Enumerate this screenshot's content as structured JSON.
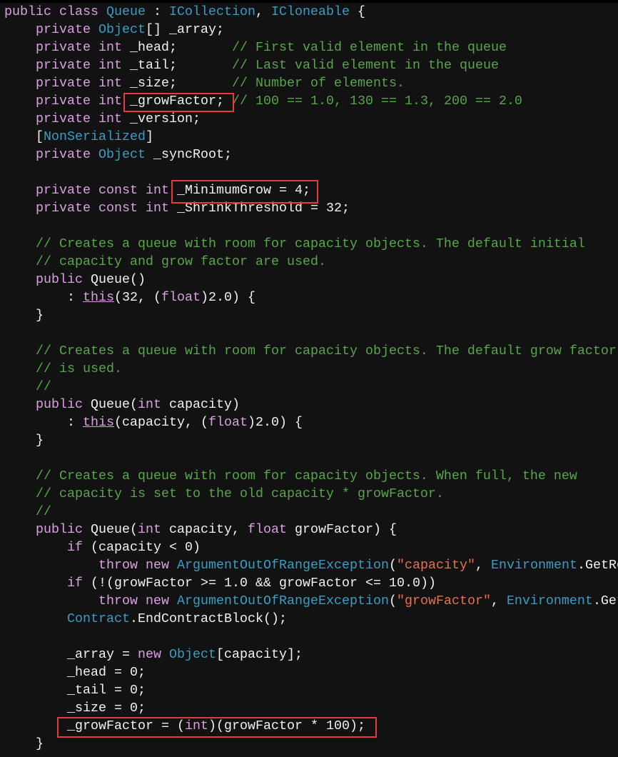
{
  "colors": {
    "background": "#121212",
    "keyword": "#d8a0df",
    "type": "#3a9dc4",
    "comment": "#57a64a",
    "string": "#e8704f",
    "text": "#f1f1f1",
    "highlight_box": "#e8393b"
  },
  "code_lines": [
    [
      [
        "k",
        "public"
      ],
      " ",
      [
        "k",
        "class"
      ],
      " ",
      [
        "t",
        "Queue"
      ],
      " : ",
      [
        "t",
        "ICollection"
      ],
      ", ",
      [
        "t",
        "ICloneable"
      ],
      " {"
    ],
    [
      "    ",
      [
        "k",
        "private"
      ],
      " ",
      [
        "t",
        "Object"
      ],
      "[] _array;"
    ],
    [
      "    ",
      [
        "k",
        "private"
      ],
      " ",
      [
        "k",
        "int"
      ],
      " _head;       ",
      [
        "c",
        "// First valid element in the queue"
      ]
    ],
    [
      "    ",
      [
        "k",
        "private"
      ],
      " ",
      [
        "k",
        "int"
      ],
      " _tail;       ",
      [
        "c",
        "// Last valid element in the queue"
      ]
    ],
    [
      "    ",
      [
        "k",
        "private"
      ],
      " ",
      [
        "k",
        "int"
      ],
      " _size;       ",
      [
        "c",
        "// Number of elements."
      ]
    ],
    [
      "    ",
      [
        "k",
        "private"
      ],
      " ",
      [
        "k",
        "int"
      ],
      " _growFactor; ",
      [
        "c",
        "// 100 == 1.0, 130 == 1.3, 200 == 2.0"
      ]
    ],
    [
      "    ",
      [
        "k",
        "private"
      ],
      " ",
      [
        "k",
        "int"
      ],
      " _version;"
    ],
    [
      "    [",
      [
        "t",
        "NonSerialized"
      ],
      "]"
    ],
    [
      "    ",
      [
        "k",
        "private"
      ],
      " ",
      [
        "t",
        "Object"
      ],
      " _syncRoot;"
    ],
    [],
    [
      "    ",
      [
        "k",
        "private"
      ],
      " ",
      [
        "k",
        "const"
      ],
      " ",
      [
        "k",
        "int"
      ],
      " _MinimumGrow = 4;"
    ],
    [
      "    ",
      [
        "k",
        "private"
      ],
      " ",
      [
        "k",
        "const"
      ],
      " ",
      [
        "k",
        "int"
      ],
      " _ShrinkThreshold = 32;"
    ],
    [],
    [
      "    ",
      [
        "c",
        "// Creates a queue with room for capacity objects. The default initial"
      ]
    ],
    [
      "    ",
      [
        "c",
        "// capacity and grow factor are used."
      ]
    ],
    [
      "    ",
      [
        "k",
        "public"
      ],
      " Queue()"
    ],
    [
      "        : ",
      [
        "u",
        "this"
      ],
      "(32, (",
      [
        "k",
        "float"
      ],
      ")2.0) {"
    ],
    [
      "    }"
    ],
    [],
    [
      "    ",
      [
        "c",
        "// Creates a queue with room for capacity objects. The default grow factor"
      ]
    ],
    [
      "    ",
      [
        "c",
        "// is used."
      ]
    ],
    [
      "    ",
      [
        "c",
        "//"
      ]
    ],
    [
      "    ",
      [
        "k",
        "public"
      ],
      " Queue(",
      [
        "k",
        "int"
      ],
      " capacity)"
    ],
    [
      "        : ",
      [
        "u",
        "this"
      ],
      "(capacity, (",
      [
        "k",
        "float"
      ],
      ")2.0) {"
    ],
    [
      "    }"
    ],
    [],
    [
      "    ",
      [
        "c",
        "// Creates a queue with room for capacity objects. When full, the new"
      ]
    ],
    [
      "    ",
      [
        "c",
        "// capacity is set to the old capacity * growFactor."
      ]
    ],
    [
      "    ",
      [
        "c",
        "//"
      ]
    ],
    [
      "    ",
      [
        "k",
        "public"
      ],
      " Queue(",
      [
        "k",
        "int"
      ],
      " capacity, ",
      [
        "k",
        "float"
      ],
      " growFactor) {"
    ],
    [
      "        ",
      [
        "k",
        "if"
      ],
      " (capacity < 0)"
    ],
    [
      "            ",
      [
        "k",
        "throw"
      ],
      " ",
      [
        "k",
        "new"
      ],
      " ",
      [
        "t",
        "ArgumentOutOfRangeException"
      ],
      "(",
      [
        "s",
        "\"capacity\""
      ],
      ", ",
      [
        "t",
        "Environment"
      ],
      ".GetRe"
    ],
    [
      "        ",
      [
        "k",
        "if"
      ],
      " (!(growFactor >= 1.0 && growFactor <= 10.0))"
    ],
    [
      "            ",
      [
        "k",
        "throw"
      ],
      " ",
      [
        "k",
        "new"
      ],
      " ",
      [
        "t",
        "ArgumentOutOfRangeException"
      ],
      "(",
      [
        "s",
        "\"growFactor\""
      ],
      ", ",
      [
        "t",
        "Environment"
      ],
      ".Get"
    ],
    [
      "        ",
      [
        "t",
        "Contract"
      ],
      ".EndContractBlock();"
    ],
    [],
    [
      "        _array = ",
      [
        "k",
        "new"
      ],
      " ",
      [
        "t",
        "Object"
      ],
      "[capacity];"
    ],
    [
      "        _head = 0;"
    ],
    [
      "        _tail = 0;"
    ],
    [
      "        _size = 0;"
    ],
    [
      "        _growFactor = (",
      [
        "k",
        "int"
      ],
      ")(growFactor * 100);"
    ],
    [
      "    }"
    ]
  ]
}
